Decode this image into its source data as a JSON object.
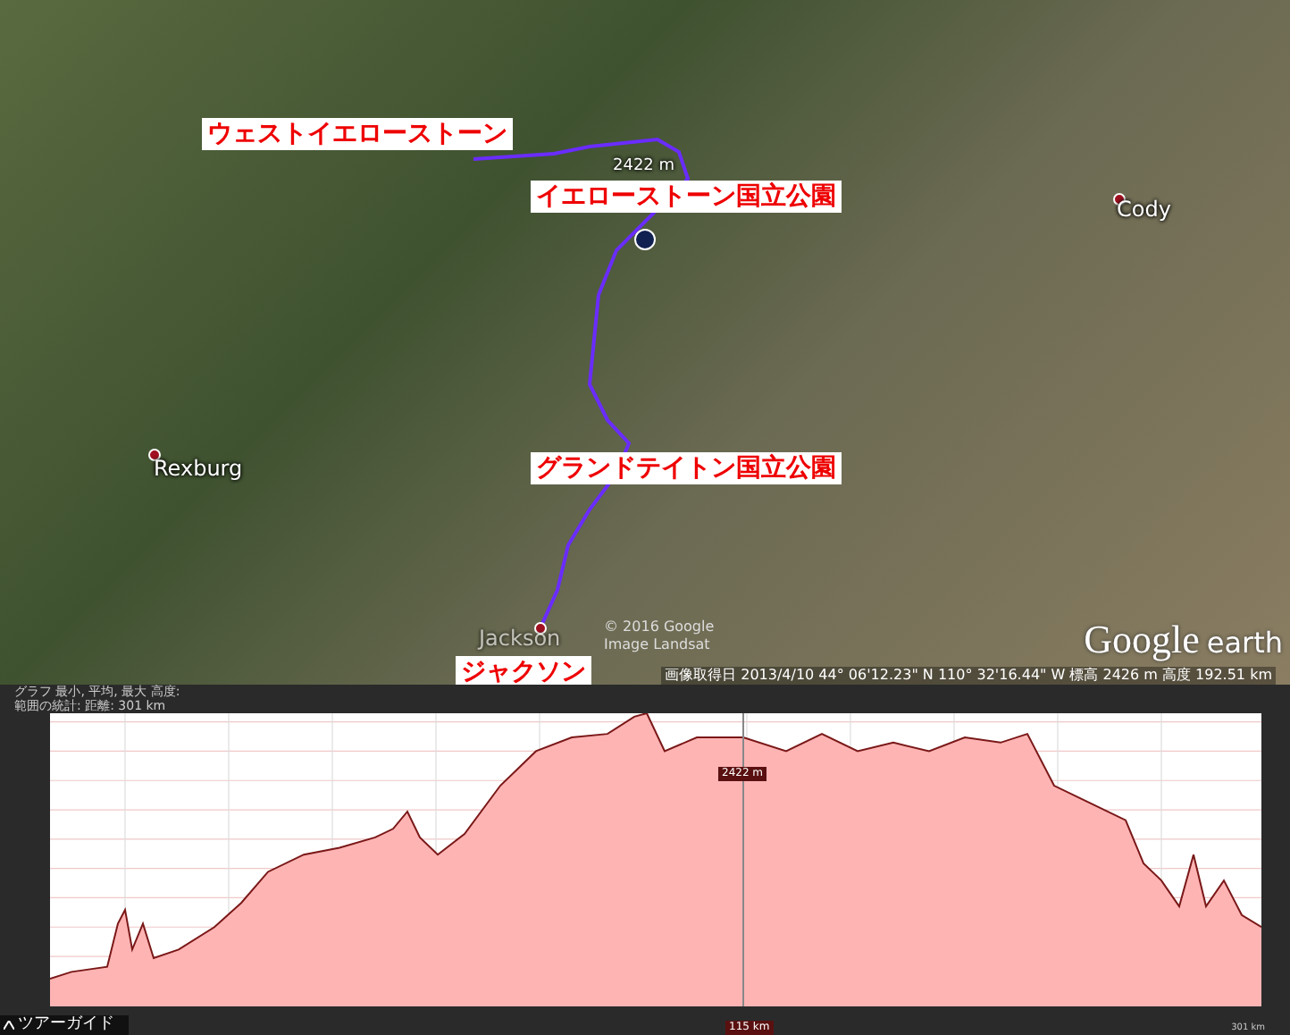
{
  "map": {
    "callouts": [
      "ウェストイエローストーン",
      "イエローストーン国立公園",
      "グランドテイトン国立公園",
      "ジャクソン"
    ],
    "place_names": [
      "Rexburg",
      "Cody",
      "Jackson"
    ],
    "elevation_marker": "2422 m",
    "attribution": [
      "© 2016 Google",
      "Image Landsat"
    ],
    "logo": {
      "brand": "Google",
      "product": "earth"
    }
  },
  "status_bar": "画像取得日 2013/4/10  44° 06'12.23\" N 110° 32'16.44\" W 標高 2426 m  高度 192.51 km",
  "elevation_profile": {
    "header": [
      "グラフ 最小, 平均, 最大 高度:",
      "範囲の統計: 距離: 301 km"
    ],
    "cursor_elevation": "2422 m",
    "cursor_distance": "115 km",
    "end_distance": "301 km"
  },
  "tour_guide": "ツアーガイド"
}
